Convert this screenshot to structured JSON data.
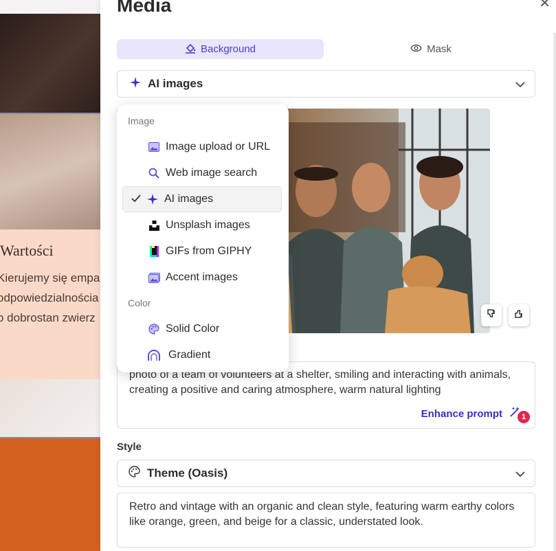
{
  "background": {
    "heading": "Wartości",
    "body_lines": [
      "Kierujemy się empa",
      "odpowiedzialnościa",
      "o dobrostan zwierz"
    ]
  },
  "panel": {
    "title": "Media",
    "tabs": [
      {
        "label": "Background",
        "active": true
      },
      {
        "label": "Mask",
        "active": false
      }
    ],
    "source_select": {
      "value": "AI images"
    },
    "dropdown": {
      "groups": [
        {
          "label": "Image",
          "items": [
            {
              "label": "Image upload or URL",
              "icon": "image-icon"
            },
            {
              "label": "Web image search",
              "icon": "search-icon"
            },
            {
              "label": "AI images",
              "icon": "sparkle-icon",
              "selected": true
            },
            {
              "label": "Unsplash images",
              "icon": "unsplash-icon"
            },
            {
              "label": "GIFs from GIPHY",
              "icon": "giphy-icon"
            },
            {
              "label": "Accent images",
              "icon": "accent-image-icon"
            }
          ]
        },
        {
          "label": "Color",
          "items": [
            {
              "label": "Solid Color",
              "icon": "palette-icon"
            },
            {
              "label": "Gradient",
              "icon": "gradient-icon"
            }
          ]
        }
      ]
    },
    "prompt": {
      "text": "photo of a team of volunteers at a shelter, smiling and interacting with animals, creating a positive and caring atmosphere, warm natural lighting",
      "enhance_label": "Enhance prompt",
      "badge_count": "1"
    },
    "style": {
      "label": "Style",
      "select_value": "Theme (Oasis)",
      "description": "Retro and vintage with an organic and clean style, featuring warm earthy colors like orange, green, and beige for a classic, understated look."
    }
  },
  "colors": {
    "accent": "#4a3fd1",
    "tab_active_bg": "#e8e5fc",
    "badge": "#e0264c",
    "sidebar_orange": "#d4621e",
    "values_bg": "#fbd9c8"
  }
}
